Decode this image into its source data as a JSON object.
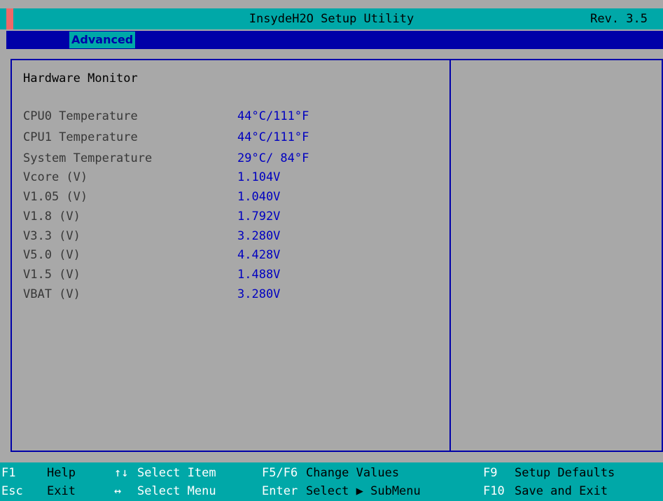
{
  "header": {
    "title": "InsydeH2O Setup Utility",
    "revision": "Rev. 3.5"
  },
  "menu": {
    "active_tab": "Advanced"
  },
  "main": {
    "section_title": "Hardware Monitor",
    "rows": [
      {
        "label": "CPU0 Temperature",
        "value": "44°C/111°F"
      },
      {
        "label": "CPU1 Temperature",
        "value": "44°C/111°F"
      },
      {
        "label": "System Temperature",
        "value": "29°C/ 84°F"
      },
      {
        "label": "Vcore (V)",
        "value": "1.104V"
      },
      {
        "label": "V1.05 (V)",
        "value": "1.040V"
      },
      {
        "label": "V1.8 (V)",
        "value": "1.792V"
      },
      {
        "label": "V3.3 (V)",
        "value": "3.280V"
      },
      {
        "label": "V5.0 (V)",
        "value": "4.428V"
      },
      {
        "label": "V1.5 (V)",
        "value": "1.488V"
      },
      {
        "label": "VBAT (V)",
        "value": "3.280V"
      }
    ]
  },
  "footer": {
    "f1_key": "F1",
    "f1_desc": "Help",
    "esc_key": "Esc",
    "esc_desc": "Exit",
    "updown_key": "↑↓",
    "updown_desc": "Select Item",
    "leftright_key": "↔",
    "leftright_desc": "Select Menu",
    "f5f6_key": "F5/F6",
    "f5f6_desc": "Change Values",
    "enter_key": "Enter",
    "enter_desc": "Select ▶ SubMenu",
    "f9_key": "F9",
    "f9_desc": "Setup Defaults",
    "f10_key": "F10",
    "f10_desc": "Save and Exit"
  },
  "colors": {
    "background": "#a8a8a8",
    "bar_cyan": "#00a8a8",
    "bar_blue": "#0000a8",
    "value_blue": "#0000c0",
    "marker_red": "#f06868"
  }
}
